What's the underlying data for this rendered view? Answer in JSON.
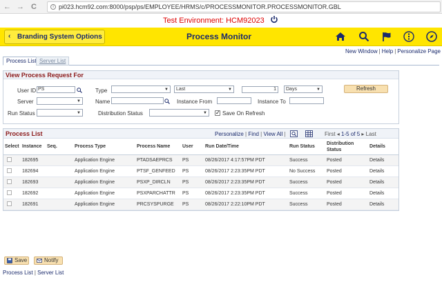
{
  "browser": {
    "back": "←",
    "forward": "→",
    "reload": "C",
    "url": "pi023.hcm92.com:8000/psp/ps/EMPLOYEE/HRMS/c/PROCESSMONITOR.PROCESSMONITOR.GBL"
  },
  "environment": {
    "text": "Test Environment: HCM92023"
  },
  "header": {
    "back_label": "Branding System Options",
    "title": "Process Monitor",
    "icons": [
      "home-icon",
      "search-icon",
      "flag-icon",
      "menu-icon",
      "compass-icon"
    ],
    "accent": "#ffe500",
    "title_color": "#1a2a6c"
  },
  "top_links": {
    "new_window": "New Window",
    "help": "Help",
    "personalize": "Personalize Page",
    "sep": "|"
  },
  "tabs": [
    {
      "label": "Process List",
      "active": true
    },
    {
      "label": "Server List",
      "active": false
    }
  ],
  "view_request": {
    "title": "View Process Request For",
    "user_id_label": "User ID",
    "user_id_value": "PS",
    "type_label": "Type",
    "type_value": "",
    "last_value": "Last",
    "last_count": "1",
    "days_value": "Days",
    "refresh_label": "Refresh",
    "server_label": "Server",
    "server_value": "",
    "name_label": "Name",
    "name_value": "",
    "instance_from_label": "Instance From",
    "instance_from_value": "",
    "instance_to_label": "Instance To",
    "instance_to_value": "",
    "run_status_label": "Run Status",
    "run_status_value": "",
    "dist_status_label": "Distribution Status",
    "dist_status_value": "",
    "save_on_refresh_label": "Save On Refresh",
    "save_on_refresh_checked": true
  },
  "process_list": {
    "title": "Process List",
    "personalize": "Personalize",
    "find": "Find",
    "view_all": "View All",
    "first": "First",
    "range": "1-5 of 5",
    "last": "Last",
    "columns": [
      "Select",
      "Instance",
      "Seq.",
      "Process Type",
      "Process Name",
      "User",
      "Run Date/Time",
      "Run Status",
      "Distribution Status",
      "Details"
    ],
    "rows": [
      {
        "instance": "182695",
        "seq": "",
        "type": "Application Engine",
        "name": "PTADSAEPRCS",
        "user": "PS",
        "datetime": "08/26/2017  4:17:57PM PDT",
        "run_status": "Success",
        "dist_status": "Posted",
        "details": "Details"
      },
      {
        "instance": "182694",
        "seq": "",
        "type": "Application Engine",
        "name": "PTSF_GENFEED",
        "user": "PS",
        "datetime": "08/26/2017  2:23:35PM PDT",
        "run_status": "No Success",
        "dist_status": "Posted",
        "details": "Details"
      },
      {
        "instance": "182693",
        "seq": "",
        "type": "Application Engine",
        "name": "PSXP_DIRCLN",
        "user": "PS",
        "datetime": "08/26/2017  2:23:35PM PDT",
        "run_status": "Success",
        "dist_status": "Posted",
        "details": "Details"
      },
      {
        "instance": "182692",
        "seq": "",
        "type": "Application Engine",
        "name": "PSXPARCHATTR",
        "user": "PS",
        "datetime": "08/26/2017  2:23:35PM PDT",
        "run_status": "Success",
        "dist_status": "Posted",
        "details": "Details"
      },
      {
        "instance": "182691",
        "seq": "",
        "type": "Application Engine",
        "name": "PRCSYSPURGE",
        "user": "PS",
        "datetime": "08/26/2017  2:22:10PM PDT",
        "run_status": "Success",
        "dist_status": "Posted",
        "details": "Details"
      }
    ]
  },
  "footer": {
    "save_label": "Save",
    "notify_label": "Notify",
    "process_list_link": "Process List",
    "sep": "|",
    "server_list_link": "Server List"
  }
}
